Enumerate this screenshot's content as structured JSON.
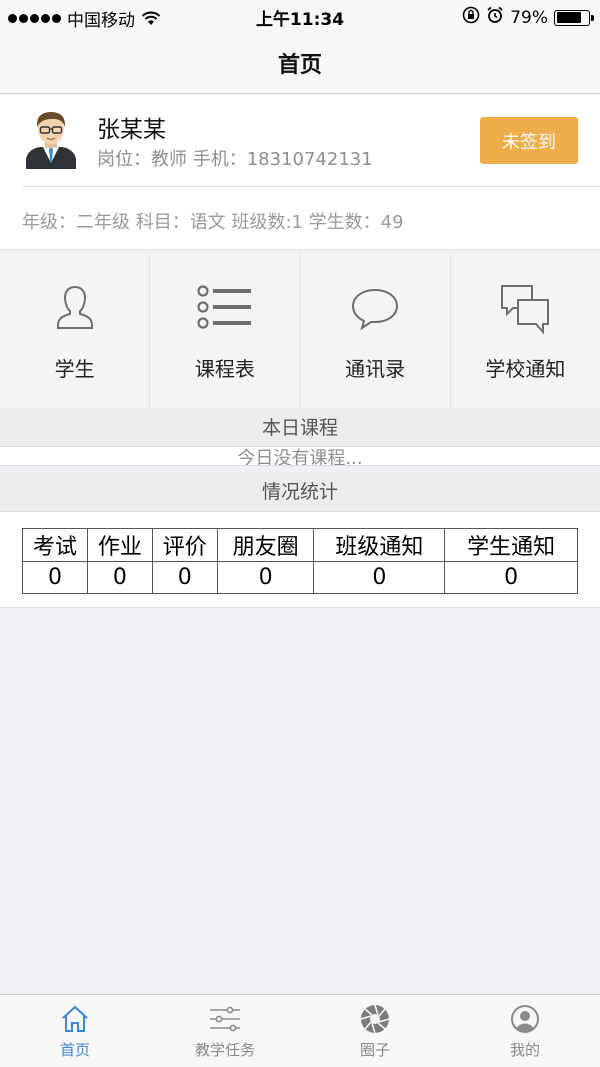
{
  "status_bar": {
    "carrier": "中国移动",
    "time": "上午11:34",
    "battery": "79%",
    "battery_level": 0.79
  },
  "nav": {
    "title": "首页"
  },
  "profile": {
    "name": "张某某",
    "meta": "岗位：教师 手机：18310742131",
    "checkin_label": "未签到",
    "class_info": "年级：二年级 科目：语文 班级数:1 学生数：49"
  },
  "menu": [
    {
      "label": "学生",
      "icon": "student-icon"
    },
    {
      "label": "课程表",
      "icon": "schedule-list-icon"
    },
    {
      "label": "通讯录",
      "icon": "chat-bubble-icon"
    },
    {
      "label": "学校通知",
      "icon": "notice-bubbles-icon"
    }
  ],
  "today_courses": {
    "header": "本日课程",
    "empty_text": "今日没有课程..."
  },
  "stats": {
    "header": "情况统计",
    "columns": [
      "考试",
      "作业",
      "评价",
      "朋友圈",
      "班级通知",
      "学生通知"
    ],
    "values": [
      "0",
      "0",
      "0",
      "0",
      "0",
      "0"
    ]
  },
  "tabs": [
    {
      "label": "首页",
      "icon": "home-icon",
      "active": true
    },
    {
      "label": "教学任务",
      "icon": "sliders-icon",
      "active": false
    },
    {
      "label": "圈子",
      "icon": "aperture-icon",
      "active": false
    },
    {
      "label": "我的",
      "icon": "user-circle-icon",
      "active": false
    }
  ],
  "colors": {
    "accent": "#efad4a",
    "tab_active": "#3d86d8",
    "background": "#efeff4"
  }
}
